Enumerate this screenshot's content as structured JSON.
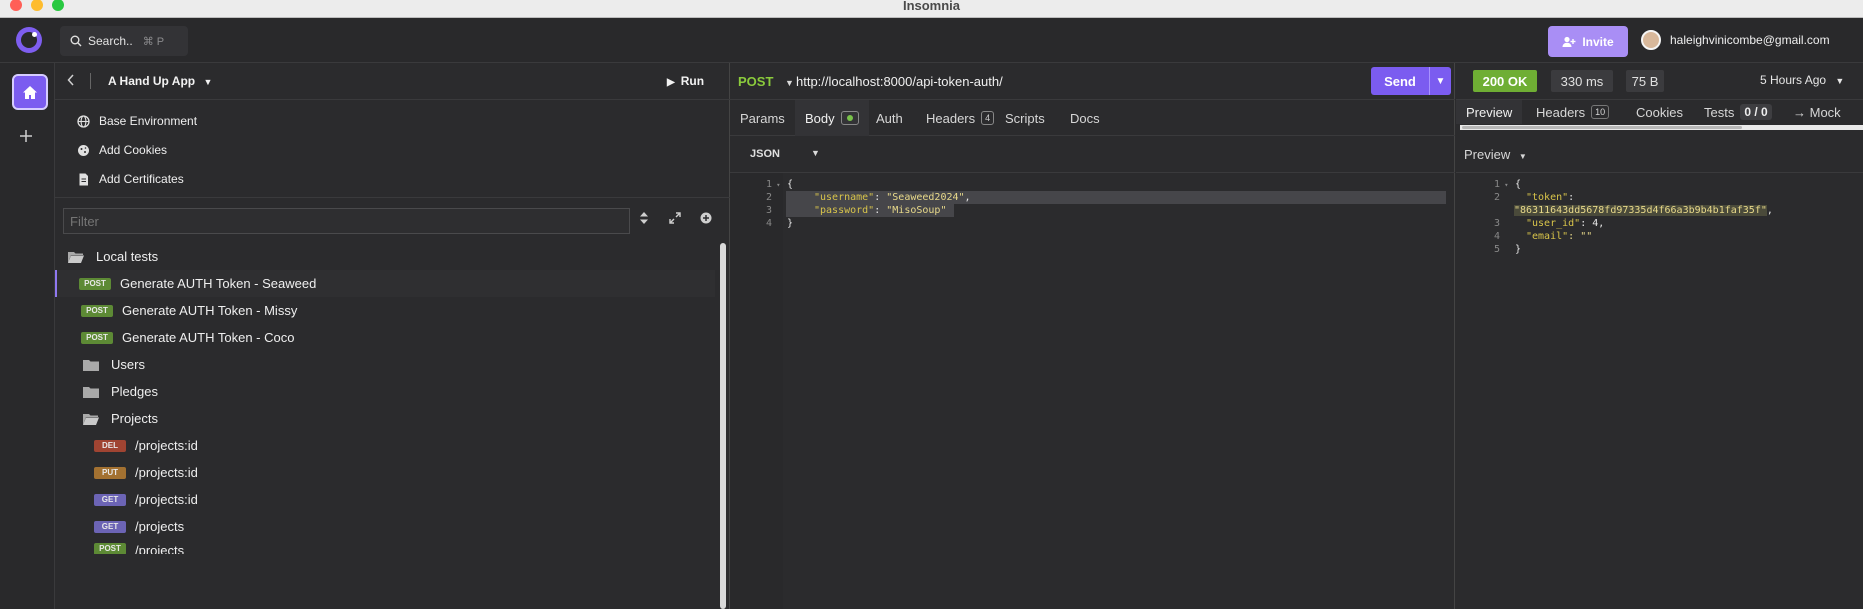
{
  "window": {
    "title": "Insomnia"
  },
  "topbar": {
    "search_label": "Search..",
    "search_shortcut": "⌘ P",
    "invite_label": "Invite",
    "user_email": "haleighvinicombe@gmail.com"
  },
  "sidebar": {
    "project_name": "A Hand Up App",
    "run_label": "Run",
    "env_items": [
      {
        "label": "Base Environment",
        "icon": "globe-icon"
      },
      {
        "label": "Add Cookies",
        "icon": "cookie-icon"
      },
      {
        "label": "Add Certificates",
        "icon": "certificate-icon"
      }
    ],
    "filter_placeholder": "Filter",
    "tree": [
      {
        "type": "folder-open",
        "label": "Local tests"
      },
      {
        "type": "request",
        "method": "POST",
        "label": "Generate AUTH Token - Seaweed",
        "active": true
      },
      {
        "type": "request",
        "method": "POST",
        "label": "Generate AUTH Token - Missy"
      },
      {
        "type": "request",
        "method": "POST",
        "label": "Generate AUTH Token - Coco"
      },
      {
        "type": "folder",
        "label": "Users"
      },
      {
        "type": "folder",
        "label": "Pledges"
      },
      {
        "type": "folder-open",
        "label": "Projects"
      },
      {
        "type": "request",
        "method": "DEL",
        "label": "/projects:id"
      },
      {
        "type": "request",
        "method": "PUT",
        "label": "/projects:id"
      },
      {
        "type": "request",
        "method": "GET",
        "label": "/projects:id"
      },
      {
        "type": "request",
        "method": "GET",
        "label": "/projects"
      },
      {
        "type": "request",
        "method": "POST",
        "label": "/projects"
      }
    ]
  },
  "request": {
    "method": "POST",
    "url": "http://localhost:8000/api-token-auth/",
    "send_label": "Send",
    "tabs": [
      {
        "label": "Params"
      },
      {
        "label": "Body",
        "active": true
      },
      {
        "label": "Auth"
      },
      {
        "label": "Headers",
        "count": "4"
      },
      {
        "label": "Scripts"
      },
      {
        "label": "Docs"
      }
    ],
    "body_type": "JSON",
    "body_lines": [
      {
        "num": "1",
        "text": "{"
      },
      {
        "num": "2",
        "key": "\"username\"",
        "value": "\"Seaweed2024\"",
        "tail": ","
      },
      {
        "num": "3",
        "key": "\"password\"",
        "value": "\"MisoSoup\"",
        "tail": ""
      },
      {
        "num": "4",
        "text": "}"
      }
    ]
  },
  "response": {
    "status": "200 OK",
    "time": "330 ms",
    "size": "75 B",
    "time_ago": "5 Hours Ago",
    "tabs": [
      {
        "label": "Preview",
        "active": true
      },
      {
        "label": "Headers",
        "count": "10"
      },
      {
        "label": "Cookies"
      },
      {
        "label": "Tests",
        "badge": "0 / 0"
      },
      {
        "label": "→ Mock"
      }
    ],
    "preview_label": "Preview",
    "lines": [
      {
        "num": "1",
        "text": "{"
      },
      {
        "num": "2",
        "key": "\"token\"",
        "tail": ":"
      },
      {
        "num": "",
        "value": "\"86311643dd5678fd97335d4f66a3b9b4b1faf35f\"",
        "tail": ","
      },
      {
        "num": "3",
        "key": "\"user_id\"",
        "tail": ": 4,"
      },
      {
        "num": "4",
        "key": "\"email\"",
        "tail": ": \"\""
      },
      {
        "num": "5",
        "text": "}"
      }
    ]
  },
  "colors": {
    "accent": "#7b5cf0",
    "post": "#5d8a35",
    "delete": "#a04432",
    "put": "#a37131",
    "get": "#6c64b5",
    "status_ok": "#6fae34"
  }
}
